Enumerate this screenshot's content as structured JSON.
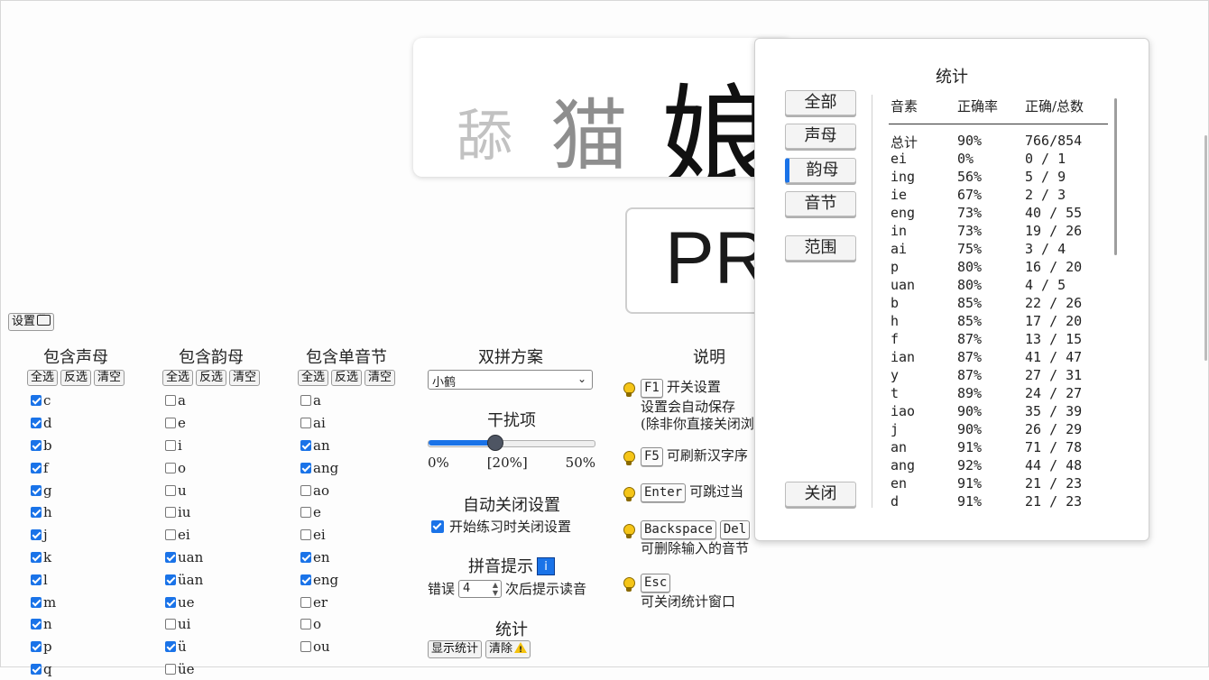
{
  "chars": [
    "舔",
    "猫",
    "娘"
  ],
  "pinyin_display": "PR",
  "settings_button": {
    "label": "设置"
  },
  "initials": {
    "title": "包含声母",
    "buttons": [
      "全选",
      "反选",
      "清空"
    ],
    "items": [
      {
        "label": "c",
        "checked": true
      },
      {
        "label": "d",
        "checked": true
      },
      {
        "label": "b",
        "checked": true
      },
      {
        "label": "f",
        "checked": true
      },
      {
        "label": "g",
        "checked": true
      },
      {
        "label": "h",
        "checked": true
      },
      {
        "label": "j",
        "checked": true
      },
      {
        "label": "k",
        "checked": true
      },
      {
        "label": "l",
        "checked": true
      },
      {
        "label": "m",
        "checked": true
      },
      {
        "label": "n",
        "checked": true
      },
      {
        "label": "p",
        "checked": true
      },
      {
        "label": "q",
        "checked": true
      }
    ]
  },
  "finals": {
    "title": "包含韵母",
    "buttons": [
      "全选",
      "反选",
      "清空"
    ],
    "items": [
      {
        "label": "a",
        "checked": false
      },
      {
        "label": "e",
        "checked": false
      },
      {
        "label": "i",
        "checked": false
      },
      {
        "label": "o",
        "checked": false
      },
      {
        "label": "u",
        "checked": false
      },
      {
        "label": "iu",
        "checked": false
      },
      {
        "label": "ei",
        "checked": false
      },
      {
        "label": "uan",
        "checked": true
      },
      {
        "label": "üan",
        "checked": true
      },
      {
        "label": "ue",
        "checked": true
      },
      {
        "label": "ui",
        "checked": false
      },
      {
        "label": "ü",
        "checked": true
      },
      {
        "label": "üe",
        "checked": false
      }
    ]
  },
  "syllables": {
    "title": "包含单音节",
    "buttons": [
      "全选",
      "反选",
      "清空"
    ],
    "items": [
      {
        "label": "a",
        "checked": false
      },
      {
        "label": "ai",
        "checked": false
      },
      {
        "label": "an",
        "checked": true
      },
      {
        "label": "ang",
        "checked": true
      },
      {
        "label": "ao",
        "checked": false
      },
      {
        "label": "e",
        "checked": false
      },
      {
        "label": "ei",
        "checked": false
      },
      {
        "label": "en",
        "checked": true
      },
      {
        "label": "eng",
        "checked": true
      },
      {
        "label": "er",
        "checked": false
      },
      {
        "label": "o",
        "checked": false
      },
      {
        "label": "ou",
        "checked": false
      }
    ]
  },
  "scheme": {
    "title": "双拼方案",
    "selected": "小鹤"
  },
  "distractor": {
    "title": "干扰项",
    "min_label": "0%",
    "value_label": "[20%]",
    "max_label": "50%",
    "value_fraction": 0.4
  },
  "auto_close": {
    "title": "自动关闭设置",
    "checkbox_label": "开始练习时关闭设置",
    "checked": true
  },
  "pinyin_hint": {
    "title": "拼音提示",
    "info_icon": "i",
    "prefix": "错误",
    "count": "4",
    "suffix": "次后提示读音"
  },
  "stats_section": {
    "title": "统计",
    "show_label": "显示统计",
    "clear_label": "清除"
  },
  "explain": {
    "title": "说明",
    "items": [
      {
        "keys": [
          "F1"
        ],
        "text": "开关设置",
        "lines": [
          "设置会自动保存",
          "(除非你直接关闭浏"
        ]
      },
      {
        "keys": [
          "F5"
        ],
        "text": "可刷新汉字序",
        "lines": []
      },
      {
        "keys": [
          "Enter"
        ],
        "text": "可跳过当",
        "lines": []
      },
      {
        "keys": [
          "Backspace",
          "Del"
        ],
        "text": "",
        "lines": [
          "可删除输入的音节"
        ]
      },
      {
        "keys": [
          "Esc"
        ],
        "text": "",
        "lines": [
          "可关闭统计窗口"
        ]
      }
    ]
  },
  "stats_modal": {
    "title": "统计",
    "tabs": [
      "全部",
      "声母",
      "韵母",
      "音节",
      "范围"
    ],
    "active_tab": "韵母",
    "close_label": "关闭",
    "headers": [
      "音素",
      "正确率",
      "正确/总数"
    ],
    "rows": [
      [
        "总计",
        "90%",
        "766/854"
      ],
      [
        "ei",
        "0%",
        "0 / 1"
      ],
      [
        "ing",
        "56%",
        "5 / 9"
      ],
      [
        "ie",
        "67%",
        "2 / 3"
      ],
      [
        "eng",
        "73%",
        "40 / 55"
      ],
      [
        "in",
        "73%",
        "19 / 26"
      ],
      [
        "ai",
        "75%",
        "3 / 4"
      ],
      [
        "p",
        "80%",
        "16 / 20"
      ],
      [
        "uan",
        "80%",
        "4 / 5"
      ],
      [
        "b",
        "85%",
        "22 / 26"
      ],
      [
        "h",
        "85%",
        "17 / 20"
      ],
      [
        "f",
        "87%",
        "13 / 15"
      ],
      [
        "ian",
        "87%",
        "41 / 47"
      ],
      [
        "y",
        "87%",
        "27 / 31"
      ],
      [
        "t",
        "89%",
        "24 / 27"
      ],
      [
        "iao",
        "90%",
        "35 / 39"
      ],
      [
        "j",
        "90%",
        "26 / 29"
      ],
      [
        "an",
        "91%",
        "71 / 78"
      ],
      [
        "ang",
        "92%",
        "44 / 48"
      ],
      [
        "en",
        "91%",
        "21 / 23"
      ],
      [
        "d",
        "91%",
        "21 / 23"
      ]
    ]
  },
  "colors": {
    "accent": "#1a73e8",
    "bulb": "#f5c518",
    "warn": "#f4c20d"
  }
}
